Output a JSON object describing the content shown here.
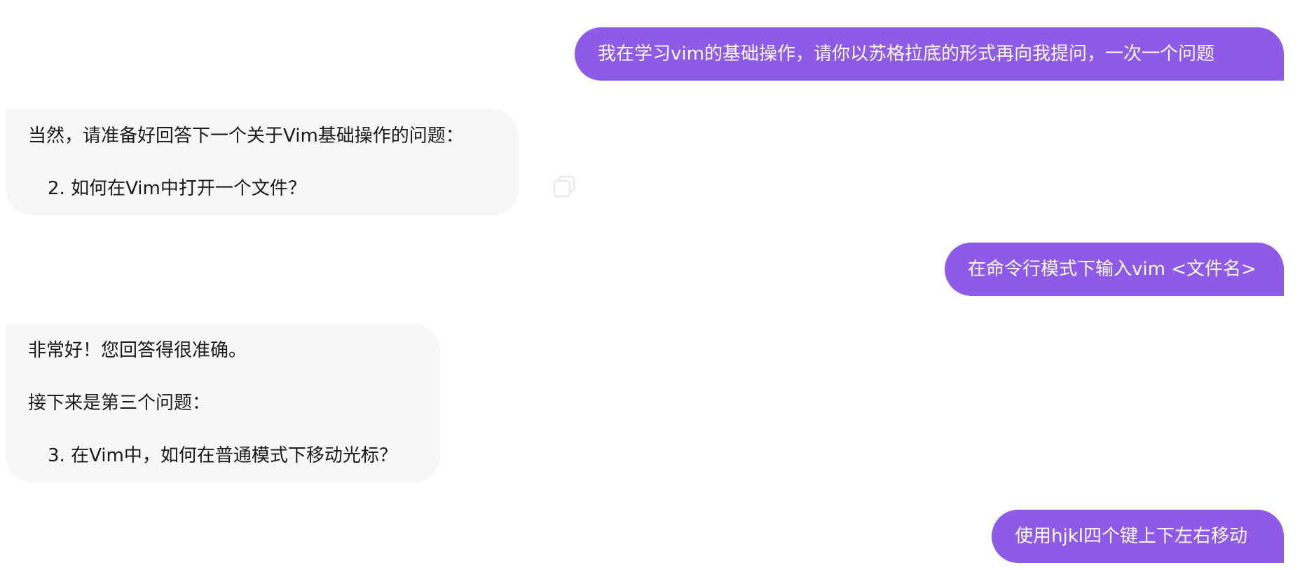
{
  "conversation": {
    "messages": [
      {
        "role": "user",
        "text": "我在学习vim的基础操作，请你以苏格拉底的形式再向我提问，一次一个问题"
      },
      {
        "role": "assistant",
        "paragraphs": [
          "当然，请准备好回答下一个关于Vim基础操作的问题：",
          "2. 如何在Vim中打开一个文件？"
        ]
      },
      {
        "role": "user",
        "text": "在命令行模式下输入vim <文件名>"
      },
      {
        "role": "assistant",
        "paragraphs": [
          "非常好！您回答得很准确。",
          "接下来是第三个问题：",
          "3. 在Vim中，如何在普通模式下移动光标？"
        ]
      },
      {
        "role": "user",
        "text": "使用hjkl四个键上下左右移动"
      }
    ]
  },
  "icons": {
    "copy": "copy-icon"
  },
  "colors": {
    "user_bubble": "#8f5ae8",
    "assistant_bubble": "#f7f7f7",
    "user_text": "#ffffff",
    "assistant_text": "#1a1a1a"
  }
}
